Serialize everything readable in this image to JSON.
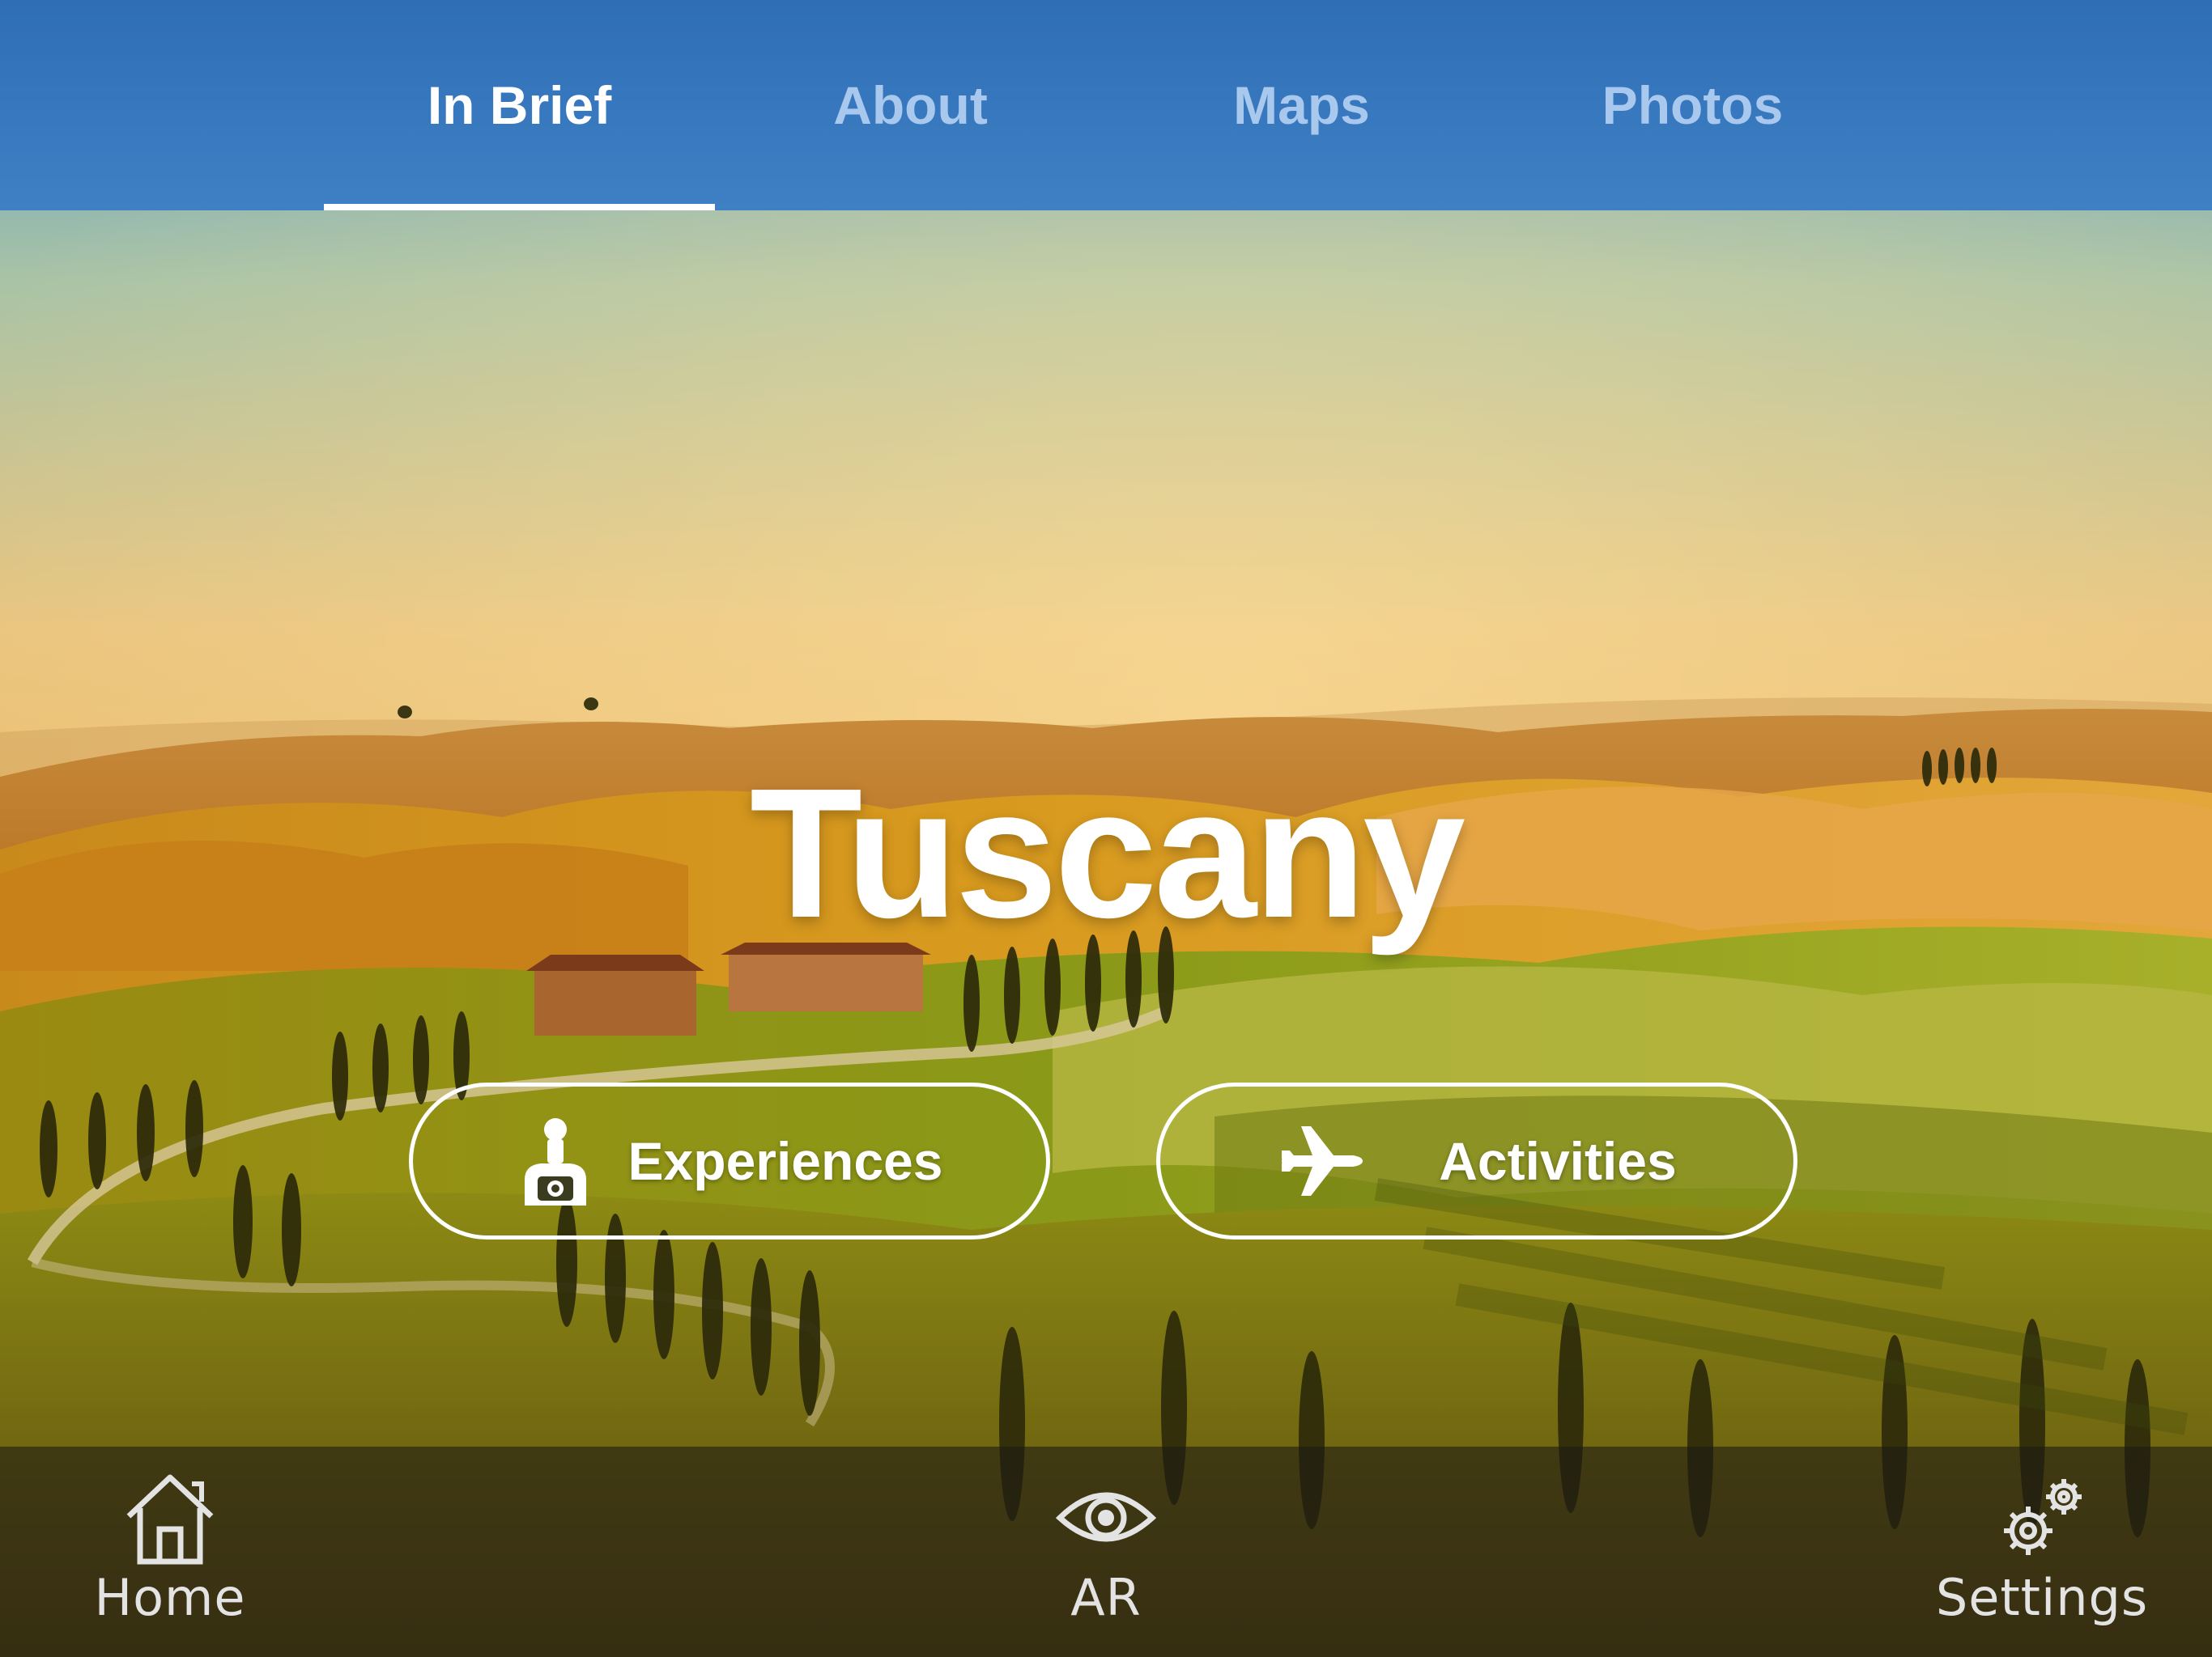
{
  "tabs": [
    {
      "label": "In Brief",
      "active": true
    },
    {
      "label": "About",
      "active": false
    },
    {
      "label": "Maps",
      "active": false
    },
    {
      "label": "Photos",
      "active": false
    }
  ],
  "hero": {
    "title": "Tuscany",
    "image_subject": "landscape-photo"
  },
  "actions": {
    "experiences": {
      "label": "Experiences",
      "icon": "photographer-icon"
    },
    "activities": {
      "label": "Activities",
      "icon": "airplane-icon"
    }
  },
  "bottom_nav": [
    {
      "label": "Home",
      "icon": "home-icon"
    },
    {
      "label": "AR",
      "icon": "eye-icon"
    },
    {
      "label": "Settings",
      "icon": "gears-icon"
    }
  ],
  "colors": {
    "top_bar": "#3776bd",
    "tab_active": "#ffffff",
    "tab_inactive": "#a9c8ee",
    "bottom_bar": "#1e1a14"
  }
}
